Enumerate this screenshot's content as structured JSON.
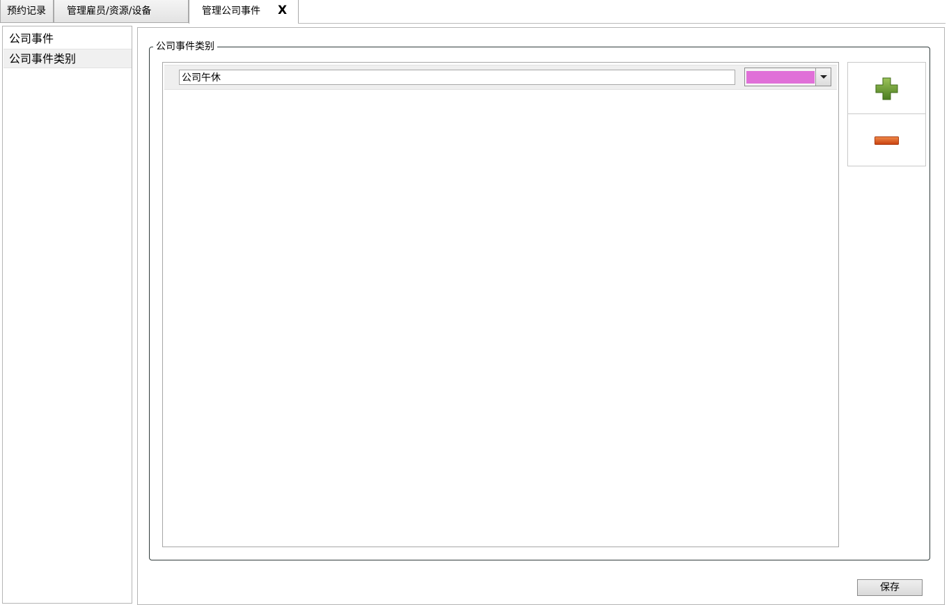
{
  "tabs": [
    {
      "label": "预约记录",
      "active": false
    },
    {
      "label": "管理雇员/资源/设备",
      "active": false
    },
    {
      "label": "管理公司事件",
      "active": true,
      "close_label": "X"
    }
  ],
  "sidebar": {
    "items": [
      {
        "label": "公司事件",
        "selected": false
      },
      {
        "label": "公司事件类别",
        "selected": true
      }
    ]
  },
  "panel": {
    "group_title": "公司事件类别",
    "categories": [
      {
        "name": "公司午休",
        "color": "#e070d8"
      }
    ],
    "add_icon": "plus-icon",
    "remove_icon": "minus-icon"
  },
  "footer": {
    "save_label": "保存"
  },
  "colors": {
    "add_green": "#5f9a2a",
    "remove_orange": "#e05a1e",
    "border": "#a9a9a9"
  }
}
